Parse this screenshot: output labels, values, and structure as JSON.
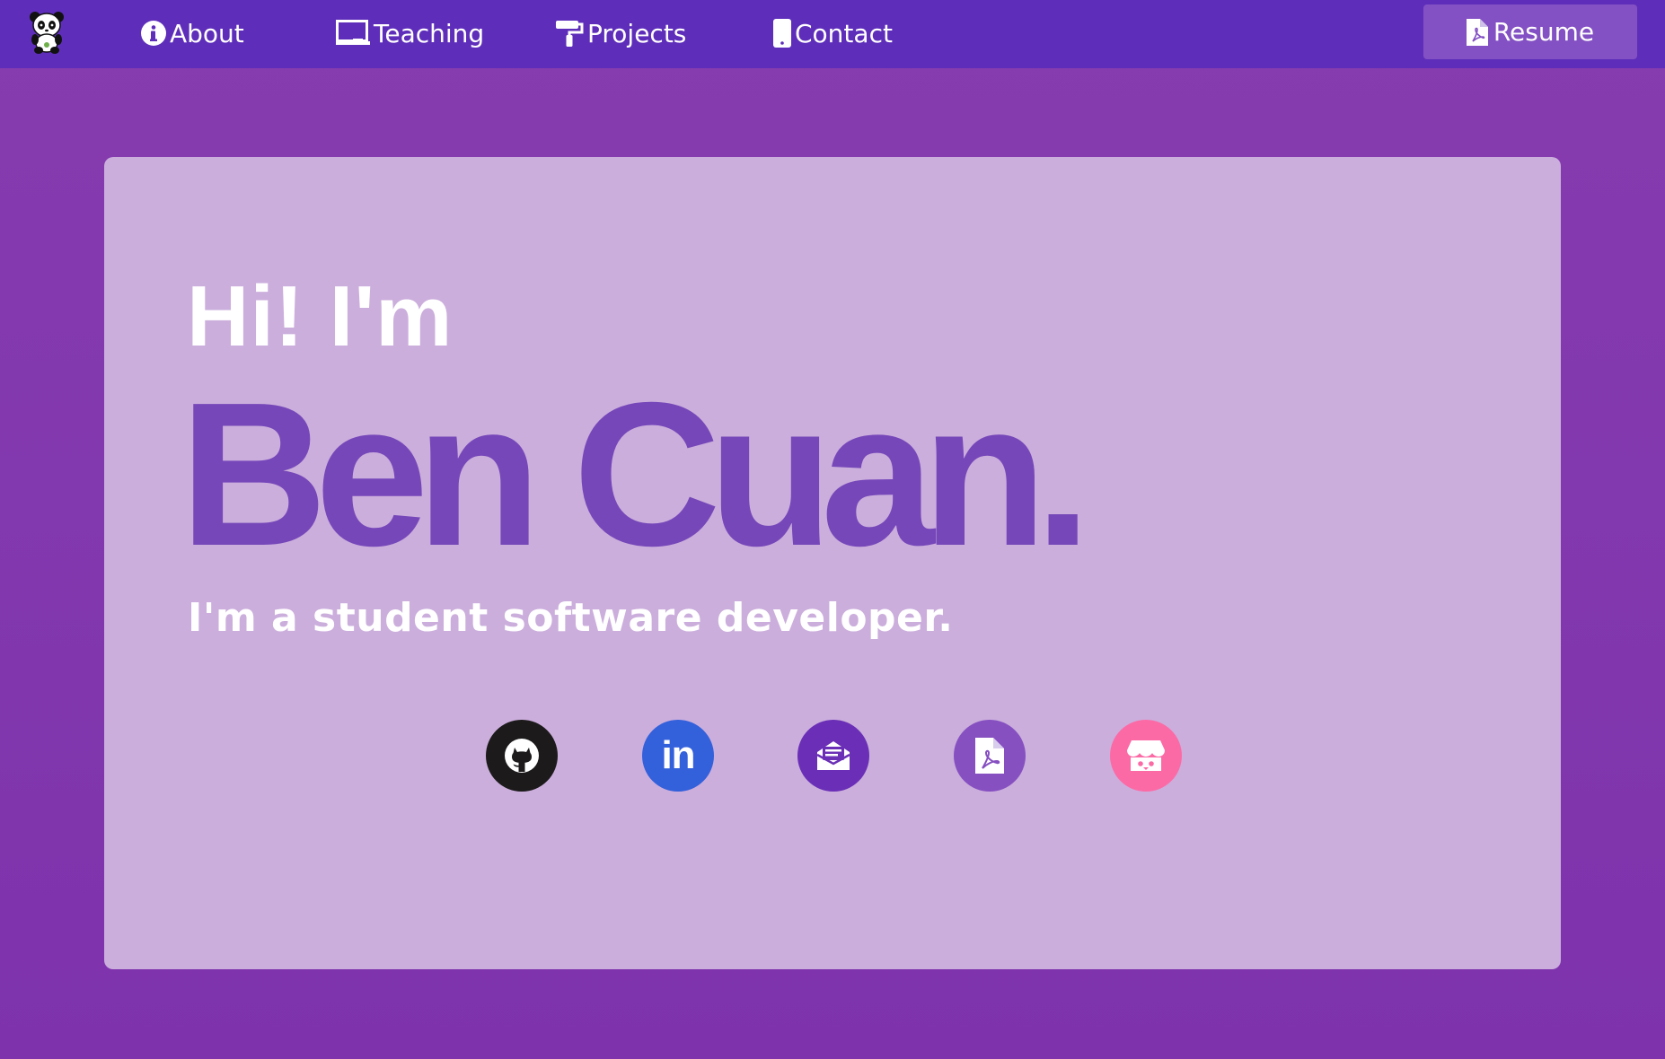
{
  "nav": {
    "logo_icon": "panda-logo-icon",
    "items": [
      {
        "label": "About",
        "icon": "info-circle-icon"
      },
      {
        "label": "Teaching",
        "icon": "chalkboard-icon"
      },
      {
        "label": "Projects",
        "icon": "paint-roller-icon"
      },
      {
        "label": "Contact",
        "icon": "mobile-phone-icon"
      }
    ],
    "resume": {
      "label": "Resume",
      "icon": "file-pdf-icon"
    }
  },
  "hero": {
    "greeting": "Hi! I'm",
    "name": "Ben Cuan.",
    "subtitle": "I'm a student software developer.",
    "social": [
      {
        "icon": "github-icon",
        "color": "#1c1a1b"
      },
      {
        "icon": "linkedin-icon",
        "text": "in",
        "color": "#3360db"
      },
      {
        "icon": "envelope-open-text-icon",
        "color": "#6a2fb6"
      },
      {
        "icon": "file-pdf-icon",
        "color": "#8650c1"
      },
      {
        "icon": "itch-io-store-icon",
        "color": "#fc6aa6"
      }
    ]
  },
  "colors": {
    "navbar": "#5e2eba",
    "page_background": "#863cae",
    "card": "#cbaedc",
    "name_accent": "#7647b9",
    "resume_button": "#8351c3"
  }
}
